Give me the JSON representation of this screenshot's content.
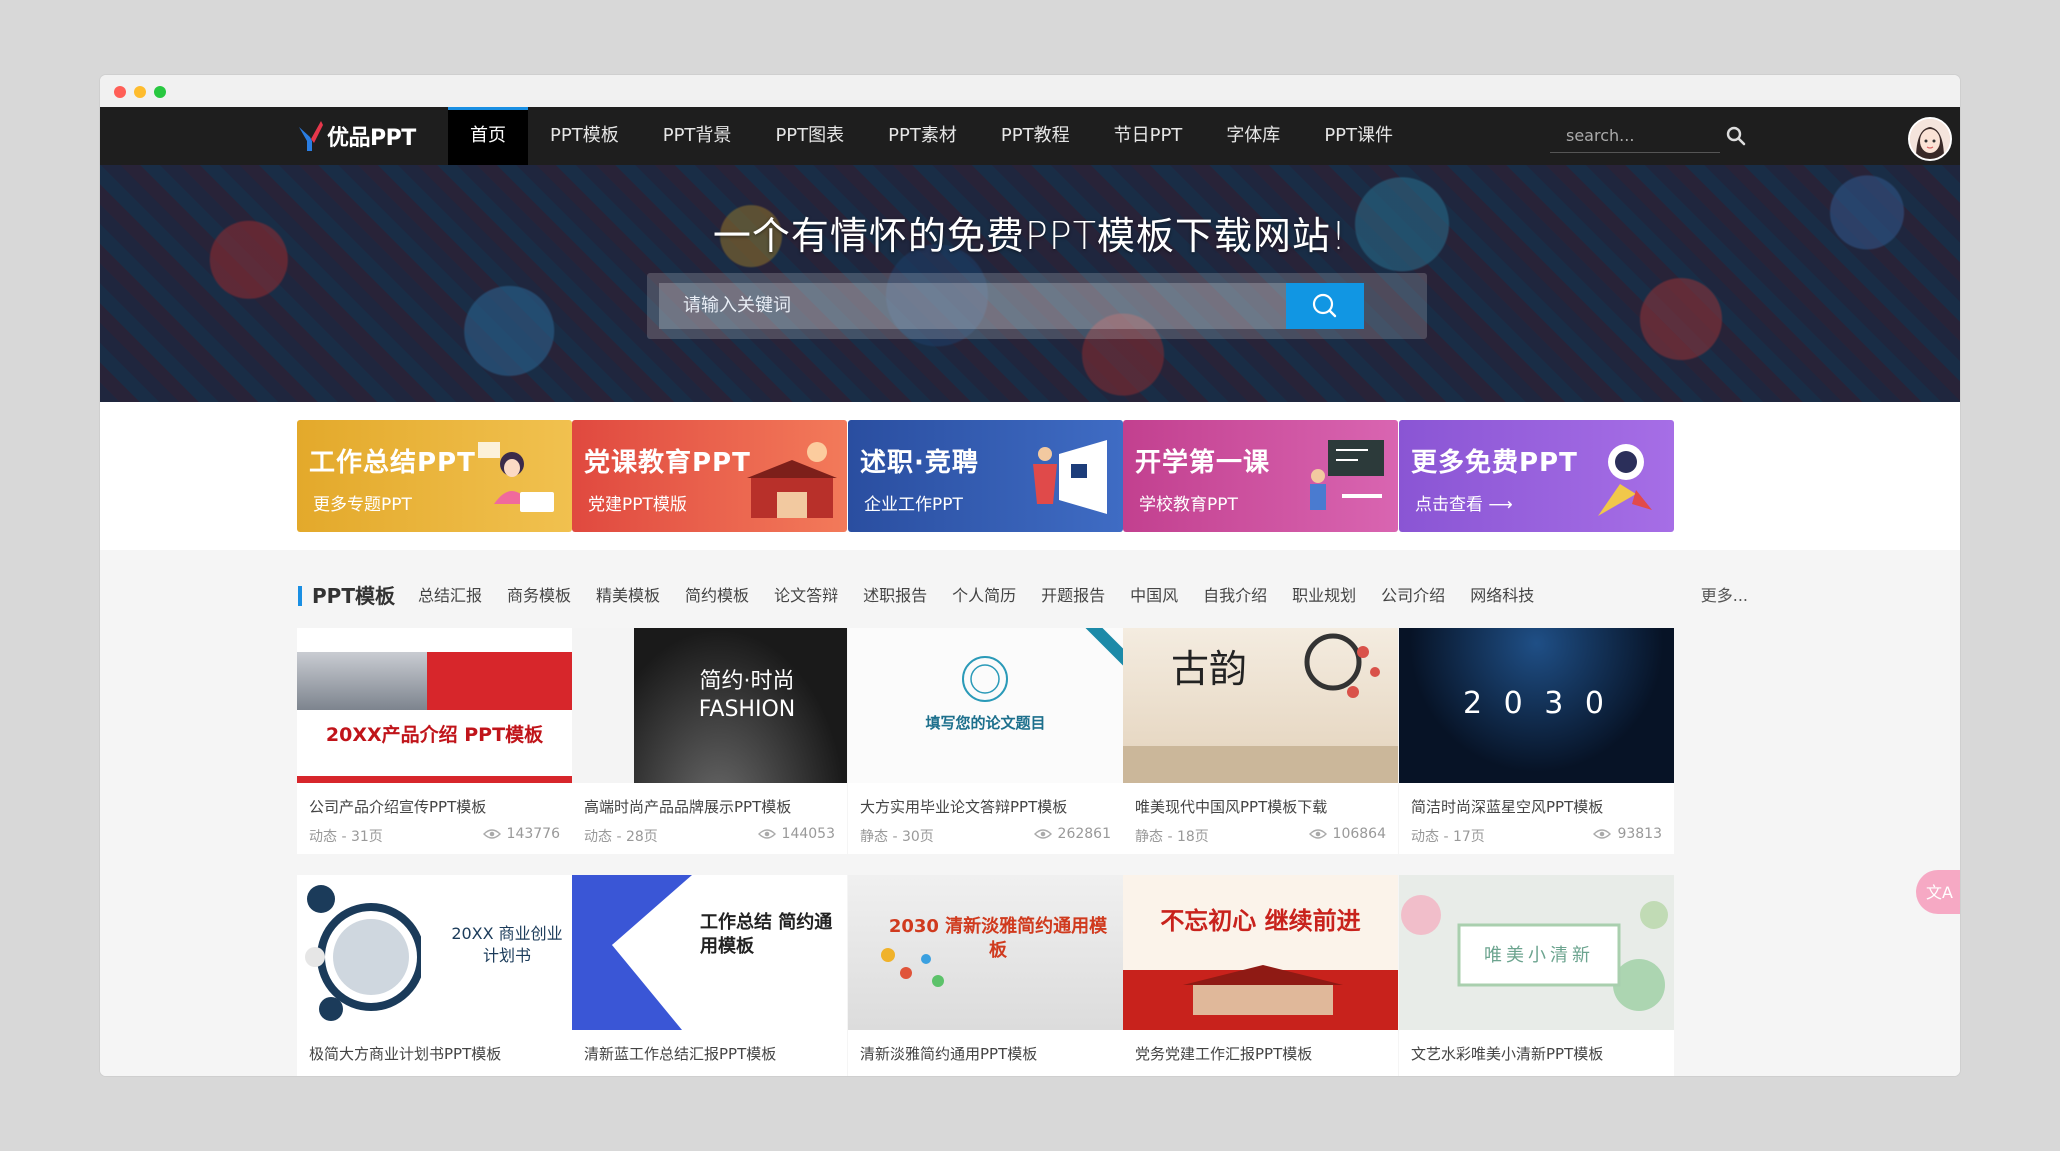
{
  "nav": {
    "logo_text": "优品PPT",
    "items": [
      {
        "label": "首页",
        "active": true
      },
      {
        "label": "PPT模板"
      },
      {
        "label": "PPT背景"
      },
      {
        "label": "PPT图表"
      },
      {
        "label": "PPT素材"
      },
      {
        "label": "PPT教程"
      },
      {
        "label": "节日PPT"
      },
      {
        "label": "字体库"
      },
      {
        "label": "PPT课件"
      }
    ],
    "search_placeholder": "search..."
  },
  "hero": {
    "title": "一个有情怀的免费PPT模板下载网站!",
    "search_placeholder": "请输入关键词"
  },
  "banners": [
    {
      "title": "工作总结PPT",
      "sub": "更多专题PPT",
      "color": "#e9b43a"
    },
    {
      "title": "党课教育PPT",
      "sub": "党建PPT模版",
      "color": "#e25b4c"
    },
    {
      "title": "述职·竞聘",
      "sub": "企业工作PPT",
      "color": "#2f57a6"
    },
    {
      "title": "开学第一课",
      "sub": "学校教育PPT",
      "color": "#c84a9a"
    },
    {
      "title": "更多免费PPT",
      "sub": "点击查看 ⟶",
      "color": "#8c5bd6"
    }
  ],
  "section": {
    "title": "PPT模板",
    "tags": [
      "总结汇报",
      "商务模板",
      "精美模板",
      "简约模板",
      "论文答辩",
      "述职报告",
      "个人简历",
      "开题报告",
      "中国风",
      "自我介绍",
      "职业规划",
      "公司介绍",
      "网络科技"
    ],
    "more": "更多..."
  },
  "cards": [
    {
      "title": "公司产品介绍宣传PPT模板",
      "meta": "动态 - 31页",
      "views": "143776",
      "thumb_text": "20XX产品介绍 PPT模板"
    },
    {
      "title": "高端时尚产品品牌展示PPT模板",
      "meta": "动态 - 28页",
      "views": "144053",
      "thumb_text": "简约·时尚 FASHION"
    },
    {
      "title": "大方实用毕业论文答辩PPT模板",
      "meta": "静态 - 30页",
      "views": "262861",
      "thumb_text": "填写您的论文题目"
    },
    {
      "title": "唯美现代中国风PPT模板下载",
      "meta": "静态 - 18页",
      "views": "106864",
      "thumb_text": "古韵"
    },
    {
      "title": "简洁时尚深蓝星空风PPT模板",
      "meta": "动态 - 17页",
      "views": "93813",
      "thumb_text": "2 0 3 0"
    },
    {
      "title": "极简大方商业计划书PPT模板",
      "meta": "",
      "views": "",
      "thumb_text": "20XX 商业创业计划书"
    },
    {
      "title": "清新蓝工作总结汇报PPT模板",
      "meta": "",
      "views": "",
      "thumb_text": "工作总结 简约通用模板"
    },
    {
      "title": "清新淡雅简约通用PPT模板",
      "meta": "",
      "views": "",
      "thumb_text": "2030 清新淡雅简约通用模板"
    },
    {
      "title": "党务党建工作汇报PPT模板",
      "meta": "",
      "views": "",
      "thumb_text": "不忘初心 继续前进"
    },
    {
      "title": "文艺水彩唯美小清新PPT模板",
      "meta": "",
      "views": "",
      "thumb_text": "唯美小清新"
    }
  ]
}
